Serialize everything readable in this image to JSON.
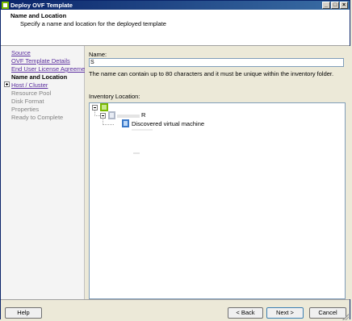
{
  "window": {
    "title": "Deploy OVF Template"
  },
  "header": {
    "title": "Name and Location",
    "subtitle": "Specify a name and location for the deployed template"
  },
  "steps": [
    {
      "label": "Source",
      "state": "link"
    },
    {
      "label": "OVF Template Details",
      "state": "link"
    },
    {
      "label": "End User License Agreement",
      "state": "link"
    },
    {
      "label": "Name and Location",
      "state": "current"
    },
    {
      "label": "Host / Cluster",
      "state": "link"
    },
    {
      "label": "Resource Pool",
      "state": "disabled"
    },
    {
      "label": "Disk Format",
      "state": "disabled"
    },
    {
      "label": "Properties",
      "state": "disabled"
    },
    {
      "label": "Ready to Complete",
      "state": "disabled"
    }
  ],
  "name_field": {
    "label": "Name:",
    "value": "S",
    "hint": "The name can contain up to 80 characters and it must be unique within the inventory folder."
  },
  "inventory": {
    "label": "Inventory Location:",
    "datacenter_text": "R",
    "folder_label": "Discovered virtual machine"
  },
  "buttons": {
    "help": "Help",
    "back": "< Back",
    "next": "Next >",
    "cancel": "Cancel"
  },
  "colors": {
    "link": "#5a2d9e",
    "titlebar": "#0a246a",
    "disabled": "#808080"
  }
}
